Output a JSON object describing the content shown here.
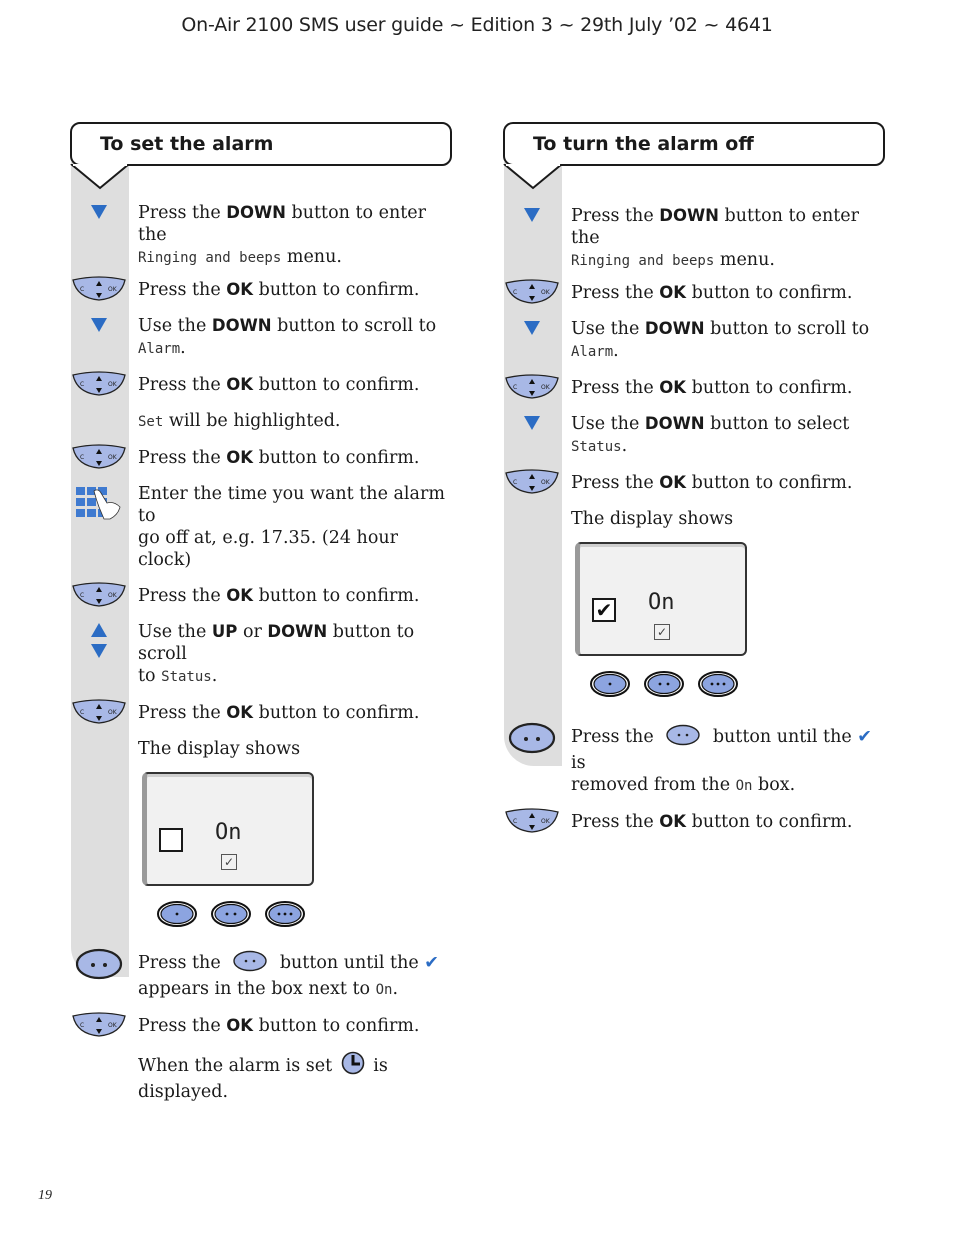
{
  "header": {
    "title": "On-Air 2100 SMS user guide ~ Edition 3 ~ 29th July ’02 ~ 4641"
  },
  "page_number": "19",
  "colors": {
    "rail": "#dedede",
    "accent_blue": "#2b6cc4",
    "key_fill": "#a8b8e6"
  },
  "set_alarm": {
    "title": "To set the alarm",
    "steps": {
      "s1": {
        "icon": "down-arrow-icon",
        "pre": "Press the ",
        "bold": "DOWN",
        "post": " button to enter the",
        "lcd": "Ringing and beeps",
        "tail": " menu."
      },
      "s2": {
        "icon": "ok-navigation-key-icon",
        "pre": "Press the ",
        "bold": "OK",
        "post": " button to confirm."
      },
      "s3": {
        "icon": "down-arrow-icon",
        "pre": "Use the ",
        "bold": "DOWN",
        "post": " button to scroll to",
        "lcd": "Alarm",
        "tail": "."
      },
      "s4": {
        "icon": "ok-navigation-key-icon",
        "pre": "Press the ",
        "bold": "OK",
        "post": " button to confirm."
      },
      "s5": {
        "lcd": "Set",
        "post": " will be highlighted."
      },
      "s6": {
        "icon": "ok-navigation-key-icon",
        "pre": "Press the ",
        "bold": "OK",
        "post": " button to confirm."
      },
      "s7": {
        "icon": "keypad-icon",
        "line1": "Enter the time you want the alarm to",
        "line2": "go off at, e.g. 17.35. (24 hour clock)"
      },
      "s8": {
        "icon": "ok-navigation-key-icon",
        "pre": "Press the ",
        "bold": "OK",
        "post": " button to confirm."
      },
      "s9": {
        "icon": "up-down-arrows-icon",
        "pre": "Use the ",
        "bold": "UP",
        "mid": " or ",
        "bold2": "DOWN",
        "post": " button to scroll",
        "pre2": "to ",
        "lcd": "Status",
        "tail": "."
      },
      "s10": {
        "icon": "ok-navigation-key-icon",
        "pre": "Press the ",
        "bold": "OK",
        "post": " button to confirm."
      },
      "s11": {
        "text": "The display shows"
      },
      "display": {
        "checkbox_checked": false,
        "label": "On",
        "checkbox_symbol": "",
        "tick_symbol": "✓"
      },
      "s12": {
        "icon": "two-dot-softkey-icon",
        "pre": "Press the ",
        "post": " button until the ",
        "check": "✔",
        "line2pre": "appears in the box next to ",
        "lcd": "On",
        "tail": "."
      },
      "s13": {
        "icon": "ok-navigation-key-icon",
        "pre": "Press the ",
        "bold": "OK",
        "post": " button to confirm."
      },
      "s14": {
        "pre": "When the alarm is set ",
        "post": " is displayed."
      }
    }
  },
  "turn_off": {
    "title": "To turn the alarm off",
    "steps": {
      "s1": {
        "pre": "Press the ",
        "bold": "DOWN",
        "post": " button to enter the",
        "lcd": "Ringing and beeps",
        "tail": " menu."
      },
      "s2": {
        "pre": "Press the ",
        "bold": "OK",
        "post": " button to confirm."
      },
      "s3": {
        "pre": "Use the ",
        "bold": "DOWN",
        "post": " button to scroll to",
        "lcd": "Alarm",
        "tail": "."
      },
      "s4": {
        "pre": "Press the ",
        "bold": "OK",
        "post": " button to confirm."
      },
      "s5": {
        "pre": "Use the ",
        "bold": "DOWN",
        "post": " button to select ",
        "lcd": "Status",
        "tail": "."
      },
      "s6": {
        "pre": "Press the ",
        "bold": "OK",
        "post": " button to confirm."
      },
      "s7": {
        "text": "The display shows"
      },
      "display": {
        "checkbox_checked": true,
        "label": "On",
        "checkbox_symbol": "✔",
        "tick_symbol": "✓"
      },
      "s8": {
        "pre": "Press the ",
        "post": " button until the ",
        "check": "✔",
        "post2": " is",
        "line2pre": "removed from the ",
        "lcd": "On",
        "tail": " box."
      },
      "s9": {
        "pre": "Press the ",
        "bold": "OK",
        "post": " button to confirm."
      }
    }
  }
}
